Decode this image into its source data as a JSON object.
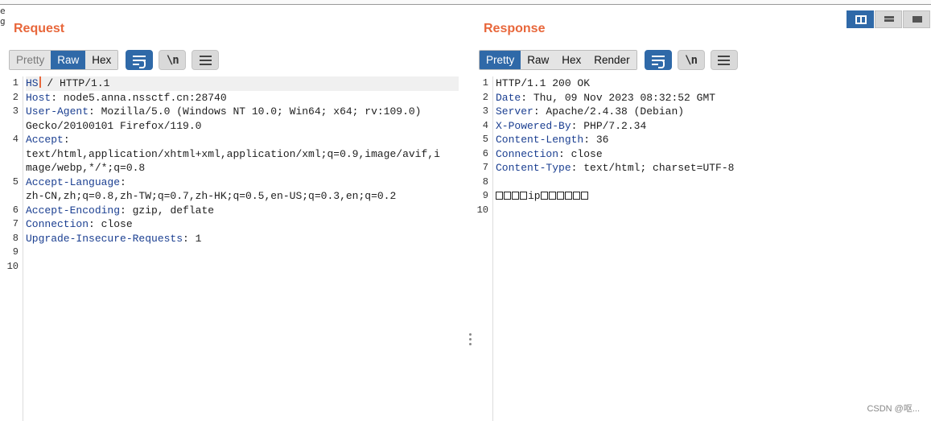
{
  "request": {
    "title": "Request",
    "tabs": [
      {
        "label": "Pretty",
        "state": "muted"
      },
      {
        "label": "Raw",
        "state": "active"
      },
      {
        "label": "Hex",
        "state": ""
      }
    ],
    "tools": {
      "wrap_icon": "word-wrap-icon",
      "newline_label": "\\n",
      "menu_icon": "hamburger-menu-icon"
    },
    "line_numbers": [
      "1",
      "2",
      "3",
      "",
      "4",
      "",
      "",
      "5",
      "",
      "6",
      "7",
      "8",
      "9",
      "10"
    ],
    "lines": [
      {
        "key": "HS",
        "val": " / HTTP/1.1"
      },
      {
        "key": "Host",
        "val": ": node5.anna.nssctf.cn:28740"
      },
      {
        "key": "User-Agent",
        "val": ": Mozilla/5.0 (Windows NT 10.0; Win64; x64; rv:109.0)"
      },
      {
        "key": "",
        "val": "Gecko/20100101 Firefox/119.0"
      },
      {
        "key": "Accept",
        "val": ":"
      },
      {
        "key": "",
        "val": "text/html,application/xhtml+xml,application/xml;q=0.9,image/avif,i"
      },
      {
        "key": "",
        "val": "mage/webp,*/*;q=0.8"
      },
      {
        "key": "Accept-Language",
        "val": ":"
      },
      {
        "key": "",
        "val": "zh-CN,zh;q=0.8,zh-TW;q=0.7,zh-HK;q=0.5,en-US;q=0.3,en;q=0.2"
      },
      {
        "key": "Accept-Encoding",
        "val": ": gzip, deflate"
      },
      {
        "key": "Connection",
        "val": ": close"
      },
      {
        "key": "Upgrade-Insecure-Requests",
        "val": ": 1"
      },
      {
        "key": "",
        "val": ""
      },
      {
        "key": "",
        "val": ""
      }
    ]
  },
  "response": {
    "title": "Response",
    "tabs": [
      {
        "label": "Pretty",
        "state": "active"
      },
      {
        "label": "Raw",
        "state": ""
      },
      {
        "label": "Hex",
        "state": ""
      },
      {
        "label": "Render",
        "state": ""
      }
    ],
    "tools": {
      "wrap_icon": "word-wrap-icon",
      "newline_label": "\\n",
      "menu_icon": "hamburger-menu-icon"
    },
    "line_numbers": [
      "1",
      "2",
      "3",
      "4",
      "5",
      "6",
      "7",
      "8",
      "9",
      "10"
    ],
    "lines": [
      {
        "key": "",
        "val": "HTTP/1.1 200 OK"
      },
      {
        "key": "Date",
        "val": ": Thu, 09 Nov 2023 08:32:52 GMT"
      },
      {
        "key": "Server",
        "val": ": Apache/2.4.38 (Debian)"
      },
      {
        "key": "X-Powered-By",
        "val": ": PHP/7.2.34"
      },
      {
        "key": "Content-Length",
        "val": ": 36"
      },
      {
        "key": "Connection",
        "val": ": close"
      },
      {
        "key": "Content-Type",
        "val": ": text/html; charset=UTF-8"
      },
      {
        "key": "",
        "val": ""
      },
      {
        "key": "",
        "val": "ip",
        "pre_boxes": 4,
        "post_boxes": 6
      },
      {
        "key": "",
        "val": ""
      }
    ]
  },
  "layout_buttons": [
    {
      "icon": "split-view-icon",
      "active": true
    },
    {
      "icon": "stacked-view-icon",
      "active": false
    },
    {
      "icon": "single-view-icon",
      "active": false
    }
  ],
  "watermark": "CSDN @呕..."
}
